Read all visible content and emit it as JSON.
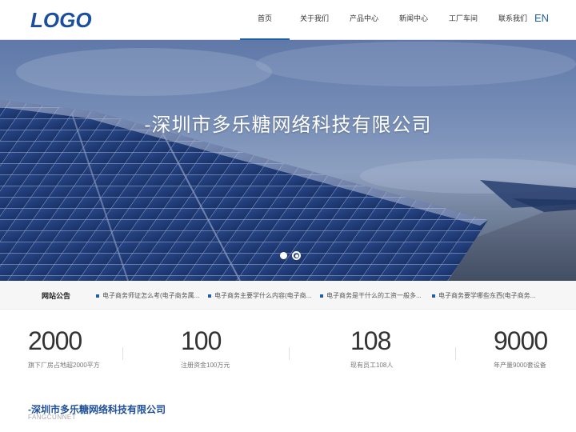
{
  "header": {
    "logo": "LOGO",
    "nav": [
      {
        "label": "首页"
      },
      {
        "label": "关于我们"
      },
      {
        "label": "产品中心"
      },
      {
        "label": "新闻中心"
      },
      {
        "label": "工厂车间"
      },
      {
        "label": "联系我们"
      }
    ],
    "lang": "EN"
  },
  "banner": {
    "title": "-深圳市多乐糖网络科技有限公司",
    "slides": 2,
    "active_slide": 2
  },
  "notice": {
    "label": "网站公告",
    "items": [
      "电子商务师证怎么考(电子商务属...",
      "电子商务主要学什么内容(电子商...",
      "电子商务是干什么的工资一般多...",
      "电子商务要学哪些东西(电子商务..."
    ]
  },
  "stats": [
    {
      "value": "2000",
      "desc": "旗下厂房占地超2000平方"
    },
    {
      "value": "100",
      "desc": "注册资金100万元"
    },
    {
      "value": "108",
      "desc": "现有员工108人"
    },
    {
      "value": "9000",
      "desc": "年产量9000套设备"
    }
  ],
  "company": {
    "name": "-深圳市多乐糖网络科技有限公司",
    "en": "FANGCUNNET"
  },
  "colors": {
    "brand": "#1f5fa8",
    "logo": "#1b4f9e"
  }
}
